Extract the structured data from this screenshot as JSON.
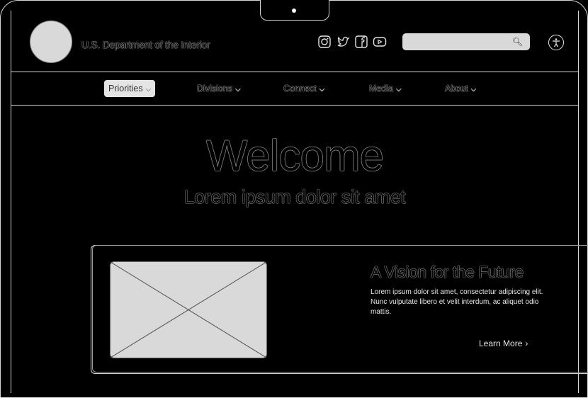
{
  "header": {
    "department": "U.S. Department of the Interior",
    "social_icons": [
      "instagram-icon",
      "twitter-icon",
      "facebook-icon",
      "youtube-icon"
    ],
    "search": {
      "placeholder": "",
      "icon": "search-icon"
    },
    "accessibility_icon": "accessibility-icon"
  },
  "nav": {
    "items": [
      {
        "label": "Priorities",
        "active": true
      },
      {
        "label": "Divisions",
        "active": false
      },
      {
        "label": "Connect",
        "active": false
      },
      {
        "label": "Media",
        "active": false
      },
      {
        "label": "About",
        "active": false
      }
    ]
  },
  "hero": {
    "title": "Welcome",
    "subtitle": "Lorem ipsum dolor sit amet"
  },
  "card": {
    "title": "A Vision for the Future",
    "body": "Lorem ipsum dolor sit amet, consectetur adipiscing elit. Nunc vulputate libero et velit interdum, ac aliquet odio mattis.",
    "link": "Learn More"
  },
  "colors": {
    "background": "#000000",
    "outline": "#d7d7d7",
    "placeholder_fill": "#d9d9d9",
    "active_nav": "#e4e4e4"
  }
}
